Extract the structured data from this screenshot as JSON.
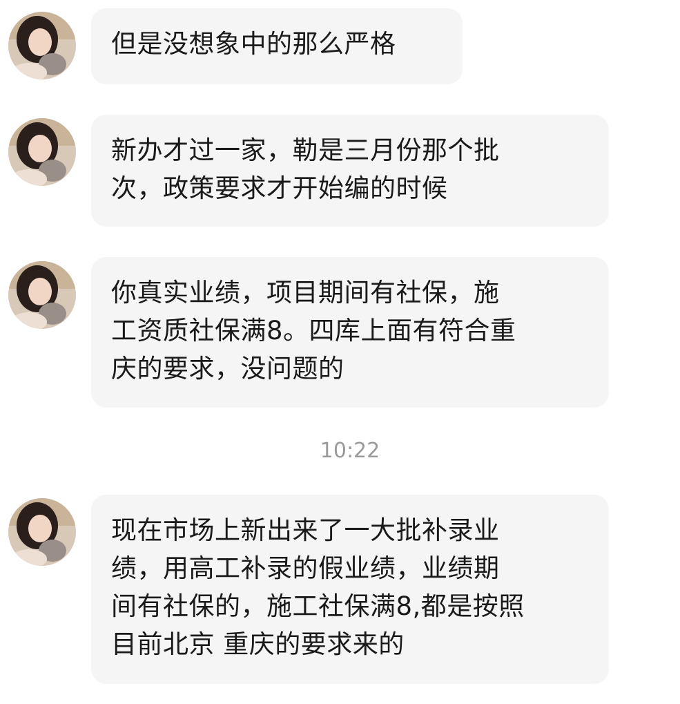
{
  "messages": [
    {
      "lines": [
        "但是没想象中的那么严格"
      ]
    },
    {
      "lines": [
        "新办才过一家，勒是三月份那个批",
        "次，政策要求才开始编的时候"
      ]
    },
    {
      "lines": [
        "你真实业绩，项目期间有社保，施",
        "工资质社保满8。四库上面有符合重",
        "庆的要求，没问题的"
      ]
    },
    {
      "lines": [
        "现在市场上新出来了一大批补录业",
        "绩，用高工补录的假业绩，业绩期",
        "间有社保的，施工社保满8,都是按照",
        "目前北京 重庆的要求来的"
      ]
    }
  ],
  "timestamp": "10:22",
  "colors": {
    "bubble": "#f5f5f5",
    "text": "#1a1a1a",
    "timestamp": "#9a9a9a"
  },
  "icons": {
    "avatar": "user-avatar-photo"
  }
}
